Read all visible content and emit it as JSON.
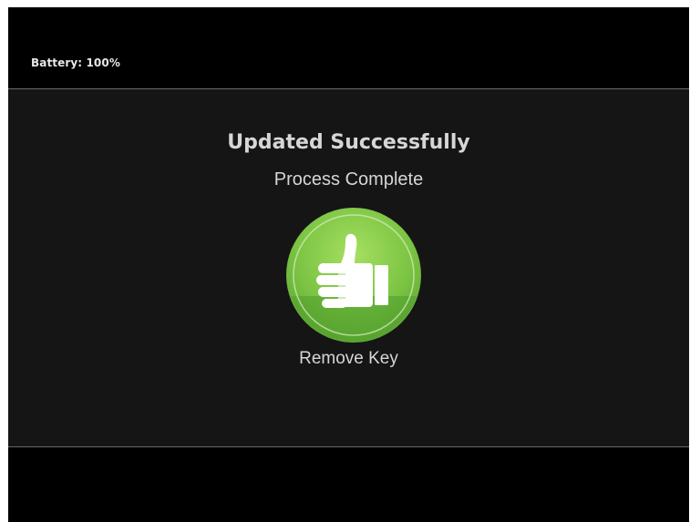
{
  "status_bar": {
    "battery_label": "Battery: 100%"
  },
  "dialog": {
    "title": "Updated Successfully",
    "subtitle": "Process Complete",
    "icon": "thumbs-up-icon",
    "instruction": "Remove Key"
  },
  "colors": {
    "background": "#151515",
    "bars": "#000000",
    "divider": "#6a6a6a",
    "text": "#d6d6d6",
    "badge_green_light": "#8fd14f",
    "badge_green_dark": "#4e9a2a"
  }
}
